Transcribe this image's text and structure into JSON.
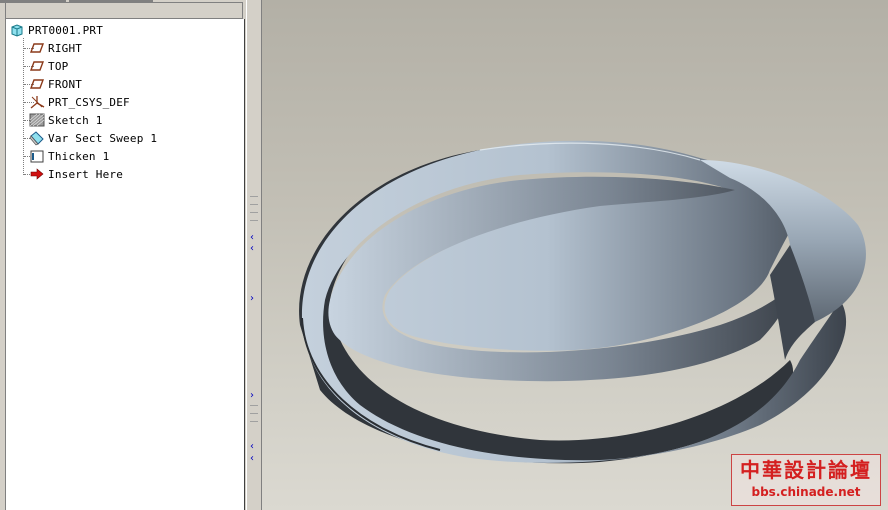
{
  "model_tree": {
    "root": "PRT0001.PRT",
    "items": [
      {
        "label": "RIGHT",
        "icon": "datum-plane-icon"
      },
      {
        "label": "TOP",
        "icon": "datum-plane-icon"
      },
      {
        "label": "FRONT",
        "icon": "datum-plane-icon"
      },
      {
        "label": "PRT_CSYS_DEF",
        "icon": "coordinate-system-icon"
      },
      {
        "label": "Sketch 1",
        "icon": "sketch-icon"
      },
      {
        "label": "Var Sect Sweep 1",
        "icon": "sweep-icon"
      },
      {
        "label": "Thicken 1",
        "icon": "thicken-icon"
      },
      {
        "label": "Insert Here",
        "icon": "insert-arrow-icon"
      }
    ]
  },
  "watermark": {
    "title": "中華設計論壇",
    "url": "bbs.chinade.net"
  },
  "colors": {
    "accent": "#d42020",
    "datum": "#8b3a1a",
    "sash_arrow": "#0000c0"
  }
}
